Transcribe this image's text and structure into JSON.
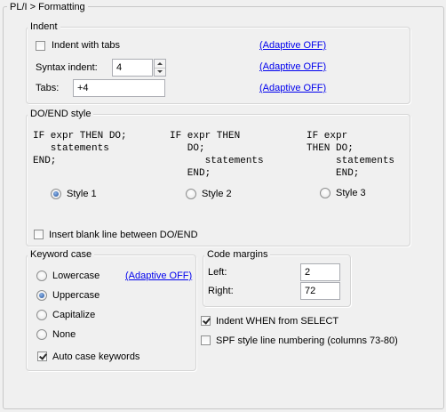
{
  "panel_title": "PL/I > Formatting",
  "indent": {
    "title": "Indent",
    "indent_with_tabs": {
      "label": "Indent with tabs",
      "checked": false
    },
    "syntax_indent_label": "Syntax indent:",
    "syntax_indent_value": "4",
    "tabs_label": "Tabs:",
    "tabs_value": "+4",
    "adaptive_links": [
      "(Adaptive OFF)",
      "(Adaptive OFF)",
      "(Adaptive OFF)"
    ]
  },
  "do_end_style": {
    "title": "DO/END style",
    "samples": [
      "IF expr THEN DO;\n   statements\nEND;",
      "IF expr THEN\n   DO;\n      statements\n   END;",
      "IF expr\nTHEN DO;\n     statements\n     END;"
    ],
    "styles": [
      {
        "label": "Style 1",
        "selected": true
      },
      {
        "label": "Style 2",
        "selected": false
      },
      {
        "label": "Style 3",
        "selected": false
      }
    ],
    "insert_blank_line": {
      "label": "Insert blank line between DO/END",
      "checked": false
    }
  },
  "keyword_case": {
    "title": "Keyword case",
    "options": [
      {
        "label": "Lowercase",
        "selected": false
      },
      {
        "label": "Uppercase",
        "selected": true
      },
      {
        "label": "Capitalize",
        "selected": false
      },
      {
        "label": "None",
        "selected": false
      }
    ],
    "adaptive_link": "(Adaptive OFF)",
    "auto_case": {
      "label": "Auto case keywords",
      "checked": true
    }
  },
  "code_margins": {
    "title": "Code margins",
    "left_label": "Left:",
    "left_value": "2",
    "right_label": "Right:",
    "right_value": "72"
  },
  "indent_when": {
    "label": "Indent WHEN from SELECT",
    "checked": true
  },
  "spf_numbering": {
    "label": "SPF style line numbering (columns 73-80)",
    "checked": false
  }
}
